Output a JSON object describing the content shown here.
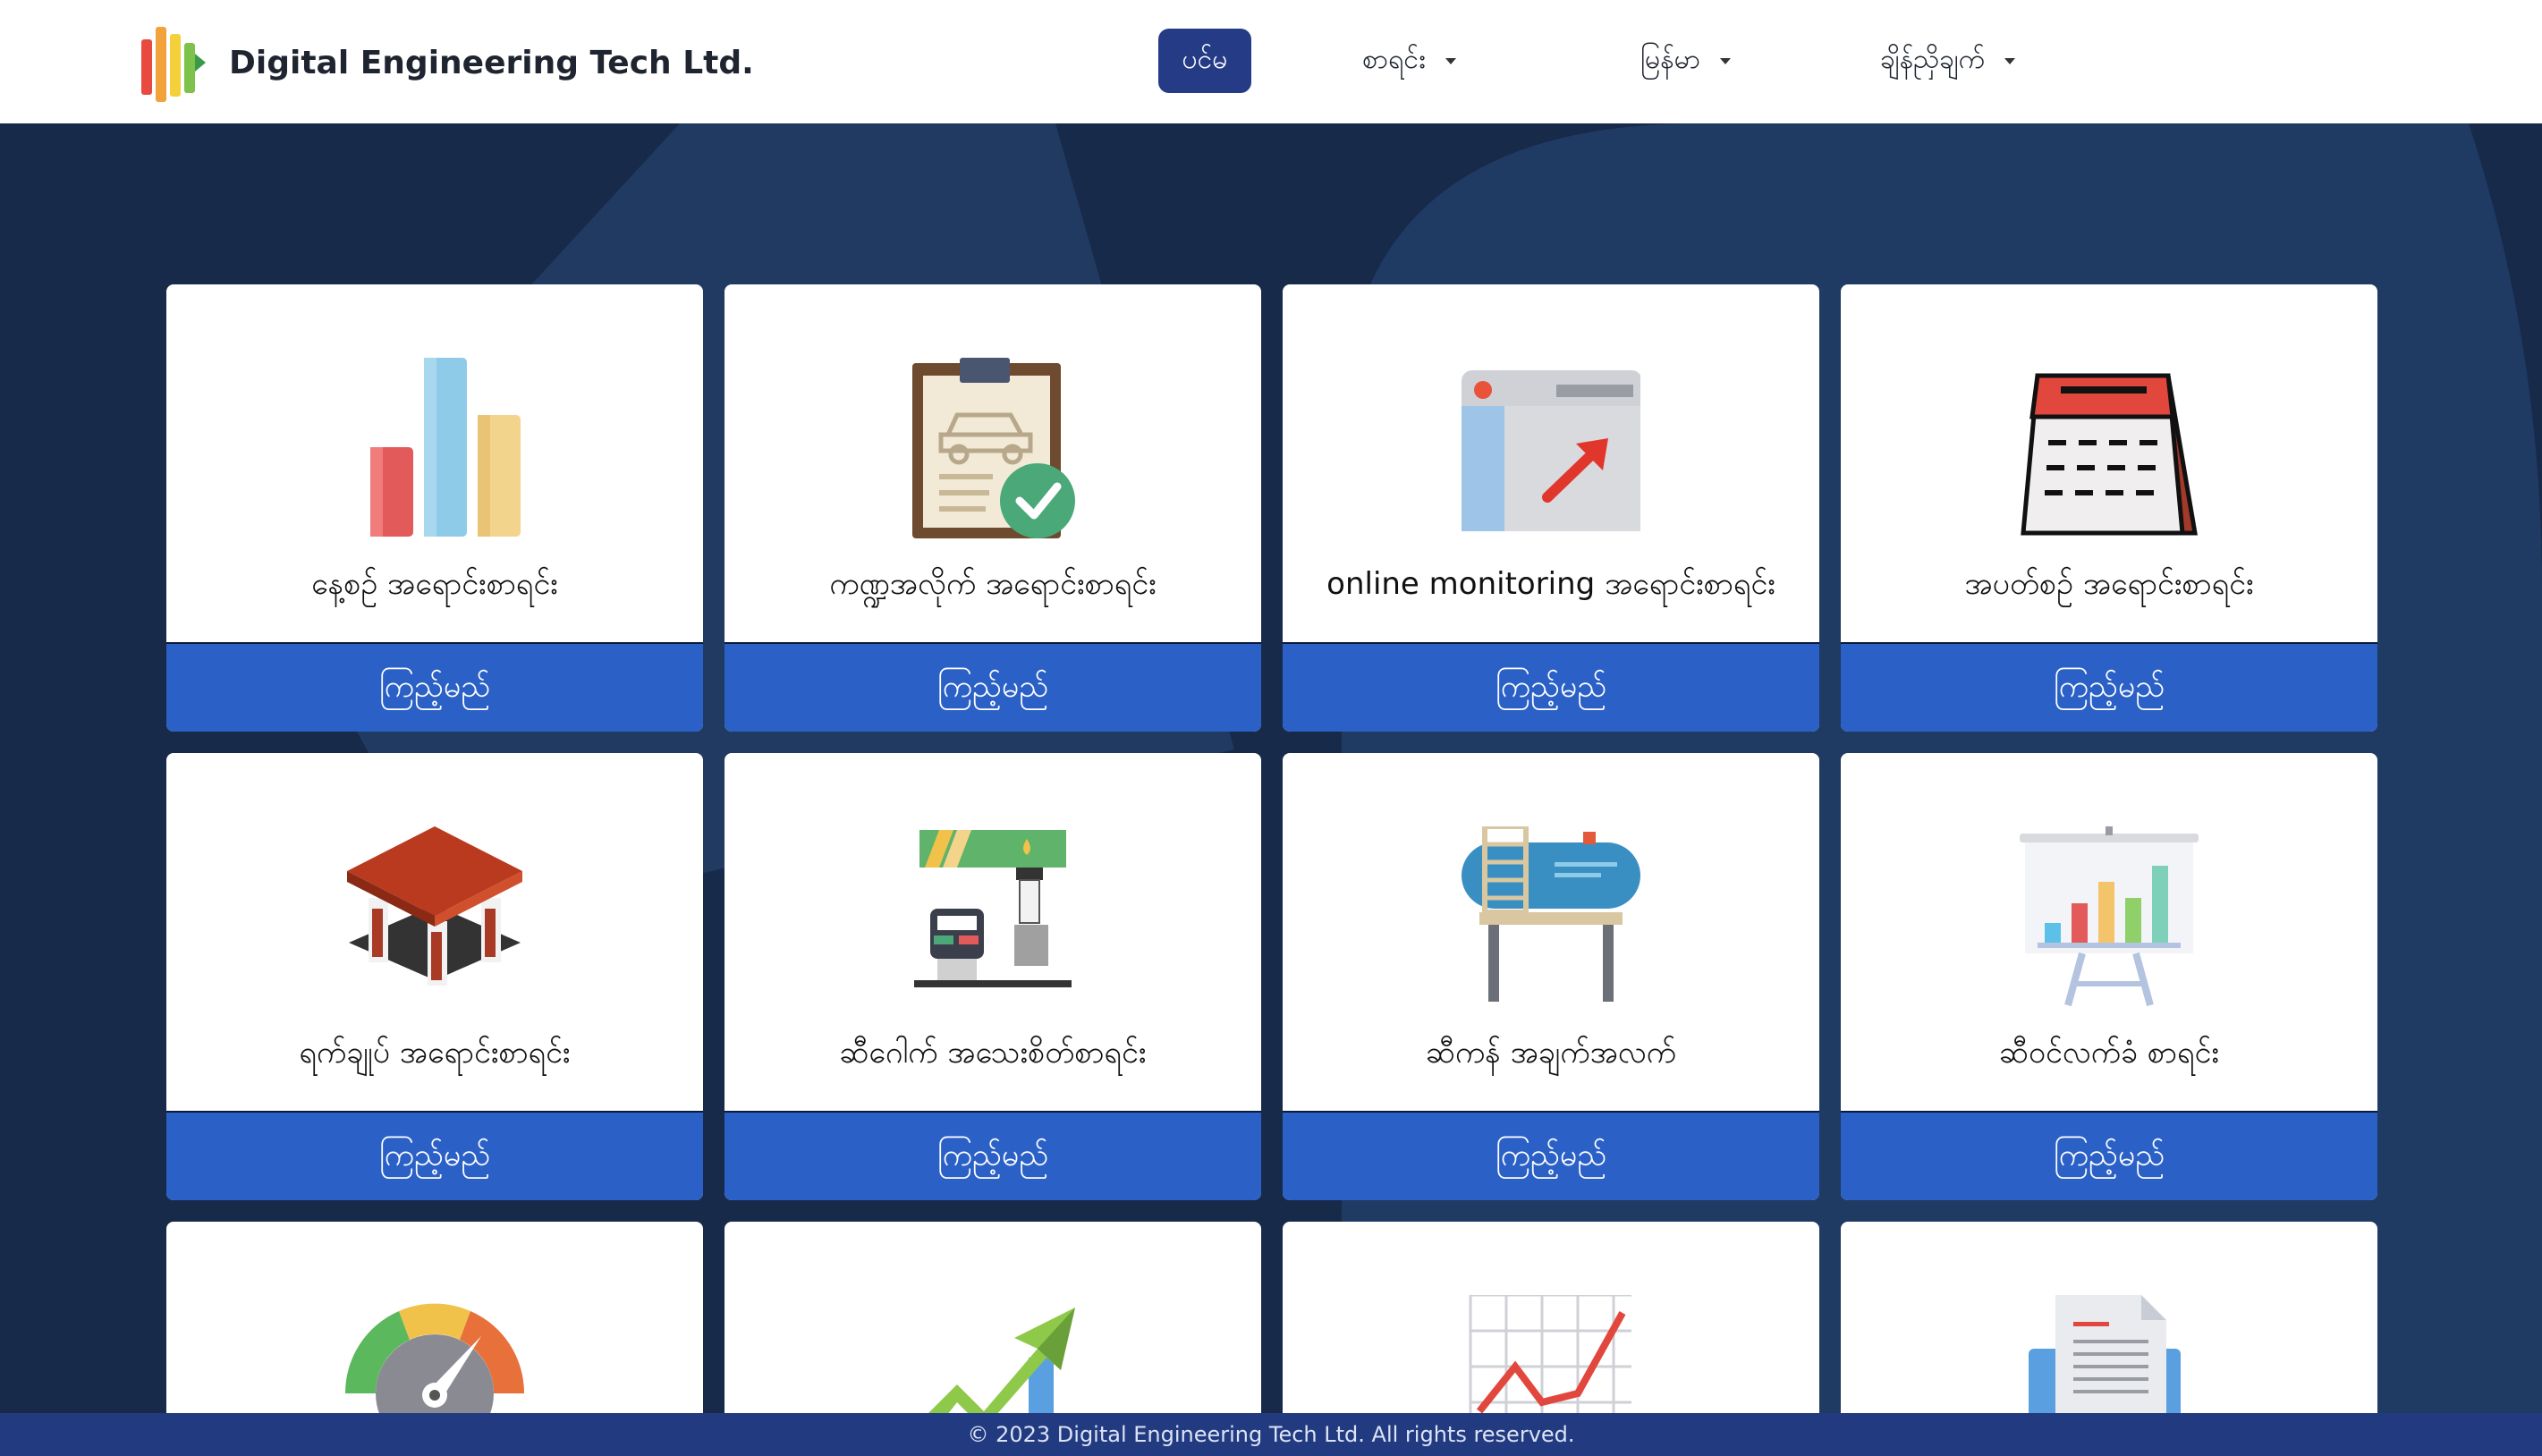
{
  "brand": {
    "name": "Digital Engineering Tech Ltd."
  },
  "nav": {
    "home": "ပင်မ",
    "list": "စာရင်း",
    "language": "မြန်မာ",
    "contact": "ချိန်ညှိချက်"
  },
  "cards": [
    {
      "title": "နေ့စဉ် အရောင်းစာရင်း",
      "button": "ကြည့်မည်",
      "icon": "bar-chart-icon"
    },
    {
      "title": "ကဏ္ဍအလိုက် အရောင်းစာရင်း",
      "button": "ကြည့်မည်",
      "icon": "clipboard-car-icon"
    },
    {
      "title": "online monitoring အရောင်းစာရင်း",
      "button": "ကြည့်မည်",
      "icon": "browser-arrow-icon"
    },
    {
      "title": "အပတ်စဉ် အရောင်းစာရင်း",
      "button": "ကြည့်မည်",
      "icon": "calendar-icon"
    },
    {
      "title": "ရက်ချုပ် အရောင်းစာရင်း",
      "button": "ကြည့်မည်",
      "icon": "gas-station-icon"
    },
    {
      "title": "ဆီဂေါက် အသေးစိတ်စာရင်း",
      "button": "ကြည့်မည်",
      "icon": "fuel-pump-icon"
    },
    {
      "title": "ဆီကန် အချက်အလက်",
      "button": "ကြည့်မည်",
      "icon": "fuel-tank-icon"
    },
    {
      "title": "ဆီဝင်လက်ခံ စာရင်း",
      "button": "ကြည့်မည်",
      "icon": "presentation-chart-icon"
    },
    {
      "title": "",
      "button": "",
      "icon": "speedometer-icon"
    },
    {
      "title": "",
      "button": "",
      "icon": "growth-arrow-icon"
    },
    {
      "title": "",
      "button": "",
      "icon": "line-graph-icon"
    },
    {
      "title": "",
      "button": "",
      "icon": "document-icon"
    }
  ],
  "footer": {
    "text": "© 2023 Digital Engineering Tech Ltd. All rights reserved."
  },
  "colors": {
    "nav_active": "#253b86",
    "card_button": "#2b61c7",
    "background": "#1a2c4c",
    "footer": "#223a80"
  }
}
